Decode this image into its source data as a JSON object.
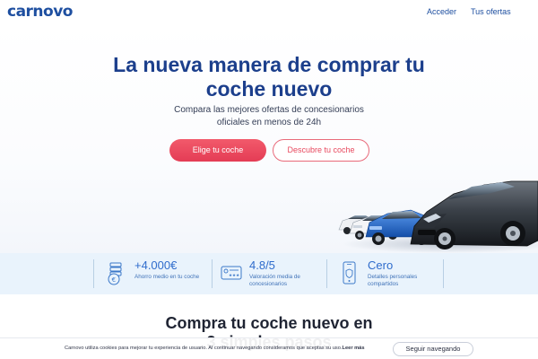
{
  "header": {
    "logo_text": "carnovo",
    "nav": {
      "login": "Acceder",
      "offers": "Tus ofertas"
    }
  },
  "hero": {
    "title_line1": "La nueva manera de comprar tu",
    "title_line2": "coche nuevo",
    "subtitle_line1": "Compara las mejores ofertas de concesionarios",
    "subtitle_line2": "oficiales en menos de 24h",
    "primary_button": "Elige tu coche",
    "secondary_button": "Descubre tu coche"
  },
  "benefits": [
    {
      "icon": "coins-icon",
      "value": "+4.000€",
      "label": "Ahorro medio en tu coche"
    },
    {
      "icon": "rating-card-icon",
      "value": "4.8/5",
      "label": "Valoración media de concesionarios"
    },
    {
      "icon": "phone-shield-icon",
      "value": "Cero",
      "label": "Detalles personales compartidos"
    }
  ],
  "section": {
    "title_line1": "Compra tu coche nuevo en",
    "title_line2": "3 simples pasos"
  },
  "cookie_bar": {
    "text": "Carnovo utiliza cookies para mejorar tu experiencia de usuario. Al continuar navegando consideramos que aceptas su uso.",
    "link": "Leer más",
    "button": "Seguir navegando"
  },
  "colors": {
    "brand": "#1e4fa0",
    "accent": "#e84a5f",
    "benefit_blue": "#2f6ccc",
    "strip_bg": "#e9f3fc"
  }
}
